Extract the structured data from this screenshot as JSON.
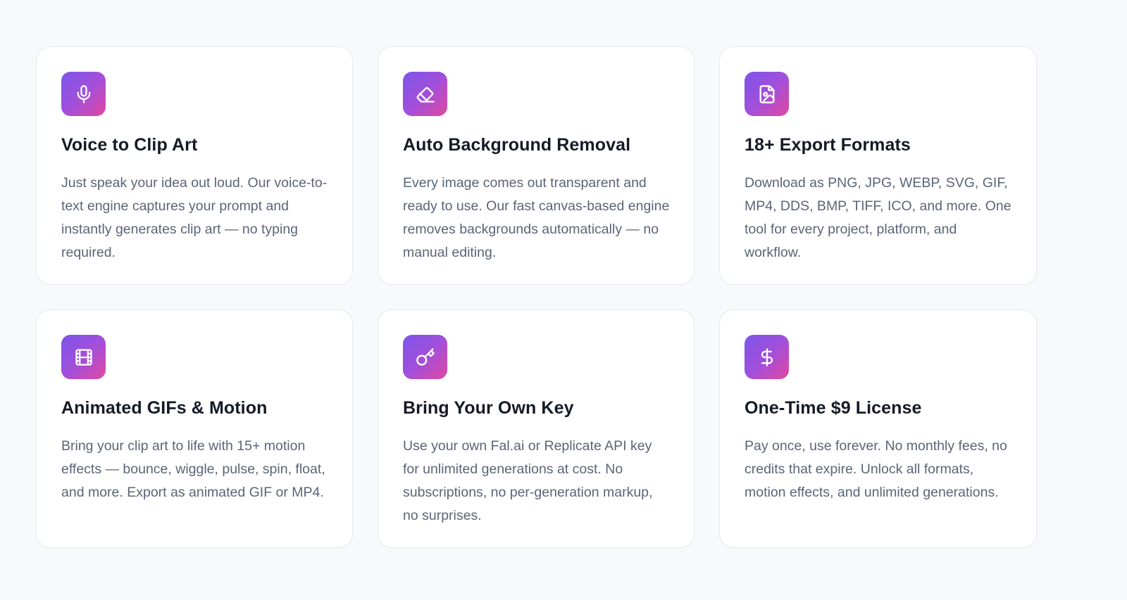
{
  "features": [
    {
      "icon": "microphone-icon",
      "title": "Voice to Clip Art",
      "description": "Just speak your idea out loud. Our voice-to-text engine captures your prompt and instantly generates clip art — no typing required."
    },
    {
      "icon": "eraser-icon",
      "title": "Auto Background Removal",
      "description": "Every image comes out transparent and ready to use. Our fast canvas-based engine removes backgrounds automatically — no manual editing."
    },
    {
      "icon": "file-image-icon",
      "title": "18+ Export Formats",
      "description": "Download as PNG, JPG, WEBP, SVG, GIF, MP4, DDS, BMP, TIFF, ICO, and more. One tool for every project, platform, and workflow."
    },
    {
      "icon": "film-icon",
      "title": "Animated GIFs & Motion",
      "description": "Bring your clip art to life with 15+ motion effects — bounce, wiggle, pulse, spin, float, and more. Export as animated GIF or MP4."
    },
    {
      "icon": "key-icon",
      "title": "Bring Your Own Key",
      "description": "Use your own Fal.ai or Replicate API key for unlimited generations at cost. No subscriptions, no per-generation markup, no surprises."
    },
    {
      "icon": "dollar-icon",
      "title": "One-Time $9 License",
      "description": "Pay once, use forever. No monthly fees, no credits that expire. Unlock all formats, motion effects, and unlimited generations."
    }
  ],
  "colors": {
    "gradient_start": "#7b55e8",
    "gradient_end": "#e0489e",
    "title": "#151a26",
    "text": "#5b6477",
    "card_border": "#e6e8ec",
    "background": "#f8f9fb"
  }
}
